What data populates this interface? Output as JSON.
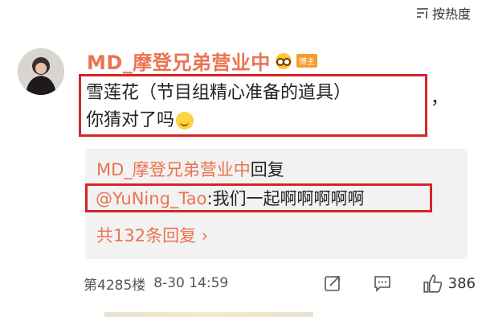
{
  "sort": {
    "label": "按热度"
  },
  "comment": {
    "username": "MD_摩登兄弟营业中",
    "badge": "博主",
    "text_line1": "雪莲花（节目组精心准备的道具）",
    "comma": "，",
    "text_line2": "你猜对了吗",
    "icons": {
      "vip": "vip-face-icon",
      "smile": "smile-emoji-icon"
    }
  },
  "reply": {
    "author": "MD_摩登兄弟营业中",
    "action": "回复",
    "mention": "@YuNing_Tao",
    "text": ":我们一起啊啊啊啊啊",
    "more": "共132条回复 ›"
  },
  "footer": {
    "floor": "第4285楼",
    "time": "8-30 14:59",
    "like_count": "386",
    "icons": [
      "share-icon",
      "comment-icon",
      "like-icon"
    ]
  },
  "colors": {
    "accent": "#eb7350",
    "highlight_border": "#d6242a",
    "reply_bg": "#f2f2f2"
  }
}
